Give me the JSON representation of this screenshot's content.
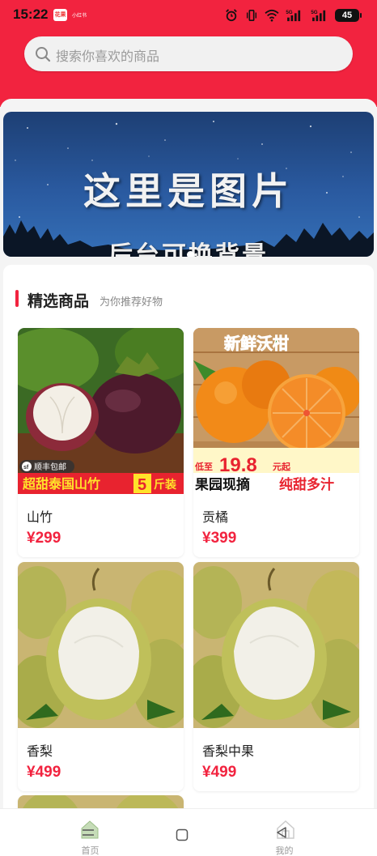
{
  "status_bar": {
    "time": "15:22",
    "app_icon_text": "花果",
    "app_label": "小红书",
    "battery": "45",
    "network_1": "5G",
    "network_2": "5G"
  },
  "search": {
    "placeholder": "搜索你喜欢的商品"
  },
  "banner": {
    "title": "这里是图片",
    "subtitle": "后台可换背景"
  },
  "section": {
    "title": "精选商品",
    "subtitle": "为你推荐好物"
  },
  "products": [
    {
      "name": "山竹",
      "price": "¥299",
      "badge": "顺丰包邮",
      "overlay_left": "超甜泰国山竹",
      "overlay_num": "5",
      "overlay_unit": "斤装"
    },
    {
      "name": "贡橘",
      "price": "¥399",
      "top_text": "新鲜沃柑",
      "price_tag_prefix": "低至",
      "price_tag_value": "19.8",
      "price_tag_suffix": "元起",
      "overlay_left": "果园现摘",
      "overlay_right": "纯甜多汁"
    },
    {
      "name": "香梨",
      "price": "¥499"
    },
    {
      "name": "香梨中果",
      "price": "¥499"
    }
  ],
  "tabbar": {
    "items": [
      {
        "label": "首页",
        "icon": "home-icon"
      },
      {
        "label": "",
        "icon": "square-nav-icon"
      },
      {
        "label": "我的",
        "icon": "user-icon"
      }
    ]
  },
  "colors": {
    "brand_red": "#f2233f",
    "price_red": "#f2233f"
  }
}
